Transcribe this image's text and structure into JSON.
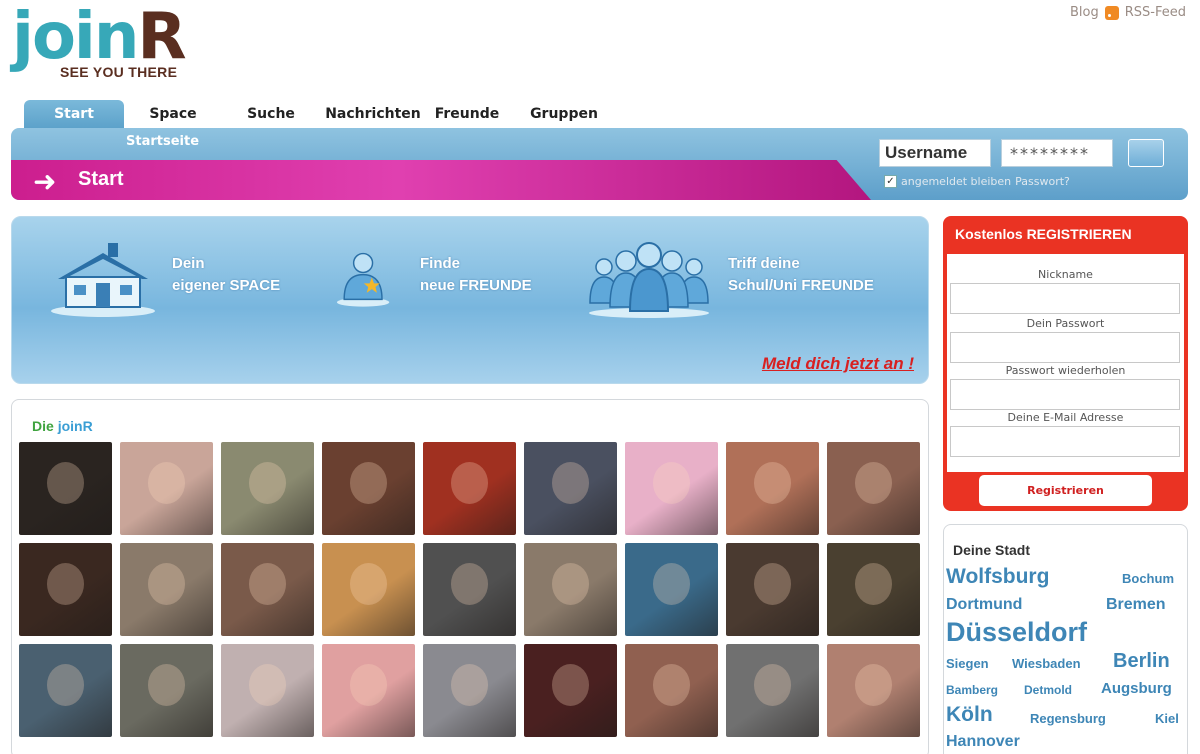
{
  "brand": {
    "logo_text_main": "join",
    "logo_text_accent": "R",
    "tagline": "SEE YOU THERE"
  },
  "toplinks": {
    "blog": "Blog",
    "rss": "RSS-Feed"
  },
  "nav": {
    "tabs": [
      "Start",
      "Space",
      "Suche",
      "Nachrichten",
      "Freunde",
      "Gruppen"
    ],
    "active": "Start",
    "subnav": "Startseite"
  },
  "banner": {
    "arrow": "➜",
    "label": "Start"
  },
  "login": {
    "username": "Username",
    "password": "********",
    "remember": "angemeldet bleiben",
    "forgot": "Passwort?"
  },
  "hero": {
    "features": [
      {
        "line1": "Dein",
        "line2": "eigener SPACE"
      },
      {
        "line1": "Finde",
        "line2": "neue FREUNDE"
      },
      {
        "line1": "Triff deine",
        "line2": "Schul/Uni FREUNDE"
      }
    ],
    "cta": "Meld dich jetzt an !"
  },
  "members": {
    "title_prefix": "Die",
    "title_brand": "joinR",
    "photos": [
      "#2a2420",
      "#c9a599",
      "#8a8a70",
      "#6a4030",
      "#a03020",
      "#4a5060",
      "#e8b0c8",
      "#b07058",
      "#8a6050",
      "#3a2820",
      "#8a7a6a",
      "#7a5a4a",
      "#c89050",
      "#505050",
      "#8a7a6a",
      "#3a6a8a",
      "#4a3a30",
      "#4a4030",
      "#4a6070",
      "#6a6a60",
      "#c0b0b0",
      "#e0a0a0",
      "#8a8a90",
      "#4a2020",
      "#906050",
      "#707070",
      "#b08070"
    ]
  },
  "register": {
    "header": "Kostenlos REGISTRIEREN",
    "fields": [
      "Nickname",
      "Dein Passwort",
      "Passwort wiederholen",
      "Deine E-Mail Adresse"
    ],
    "button": "Registrieren"
  },
  "city": {
    "title": "Deine Stadt",
    "cities": [
      "Wolfsburg",
      "Bochum",
      "Dortmund",
      "Bremen",
      "Düsseldorf",
      "Siegen",
      "Wiesbaden",
      "Berlin",
      "Bamberg",
      "Detmold",
      "Augsburg",
      "Köln",
      "Regensburg",
      "Kiel",
      "Hannover"
    ]
  }
}
